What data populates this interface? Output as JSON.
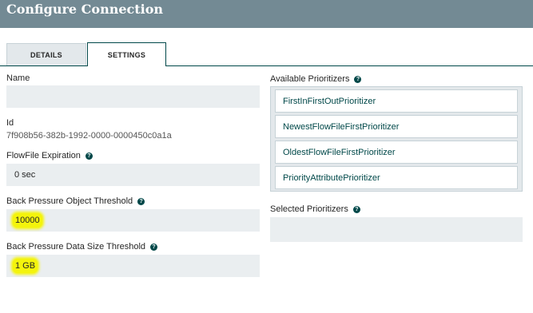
{
  "dialog": {
    "title": "Configure Connection"
  },
  "tabs": [
    {
      "label": "DETAILS"
    },
    {
      "label": "SETTINGS"
    }
  ],
  "settings": {
    "name_label": "Name",
    "name_value": "",
    "id_label": "Id",
    "id_value": "7f908b56-382b-1992-0000-0000450c0a1a",
    "expiration_label": "FlowFile Expiration",
    "expiration_value": "0 sec",
    "bp_object_label": "Back Pressure Object Threshold",
    "bp_object_value": "10000",
    "bp_size_label": "Back Pressure Data Size Threshold",
    "bp_size_value": "1 GB",
    "available_label": "Available Prioritizers",
    "prioritizers": [
      "FirstInFirstOutPrioritizer",
      "NewestFlowFileFirstPrioritizer",
      "OldestFlowFileFirstPrioritizer",
      "PriorityAttributePrioritizer"
    ],
    "selected_label": "Selected Prioritizers",
    "help_glyph": "?"
  },
  "highlight_color": "#f4f40c",
  "header_color": "#738a94",
  "accent_color": "#004849"
}
